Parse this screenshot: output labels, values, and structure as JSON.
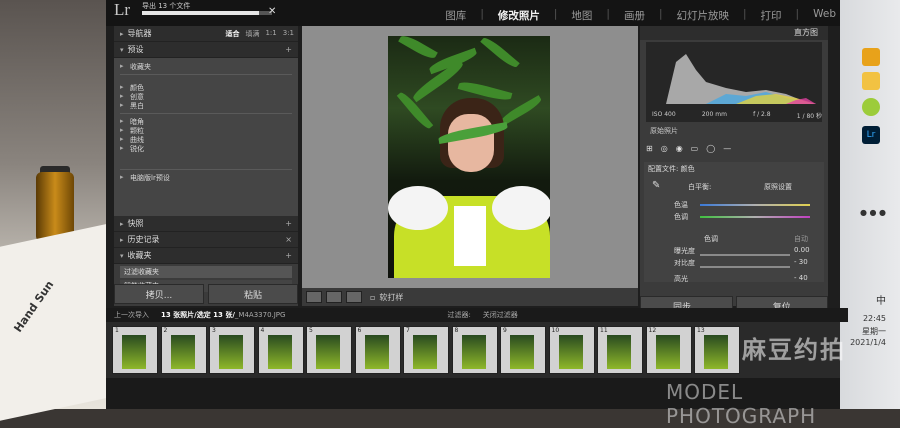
{
  "import": {
    "label": "导出 13 个文件",
    "progress_pct": 90,
    "close": "✕"
  },
  "logo": "Lr",
  "modules": [
    "图库",
    "修改照片",
    "地图",
    "画册",
    "幻灯片放映",
    "打印",
    "Web"
  ],
  "active_module": "修改照片",
  "left": {
    "navigator": {
      "title": "导航器",
      "opts": [
        "适合",
        "填满",
        "1:1",
        "3:1"
      ]
    },
    "presets": {
      "title": "预设",
      "items": [
        "收藏夹",
        "颜色",
        "创意",
        "黑白",
        "暗角",
        "颗粒",
        "曲线",
        "锐化",
        "电脑版lr预设"
      ]
    },
    "snapshots": "快照",
    "history": "历史记录",
    "collections": "收藏夹",
    "collection_items": [
      "过滤收藏夹",
      "智能收藏夹"
    ],
    "copy": "拷贝...",
    "paste": "粘贴"
  },
  "toolbar": {
    "softproof": "软打样"
  },
  "right": {
    "histogram": "直方图",
    "stats": [
      "ISO 400",
      "200 mm",
      "f / 2.8",
      "1 / 80 秒"
    ],
    "original": "原始照片",
    "profile": "配置文件: 颜色",
    "wb_label": "白平衡:",
    "wb_value": "原照设置",
    "temp": "色温",
    "tint": "色调",
    "tone": "色调",
    "auto": "自动",
    "exposure": "曝光度",
    "exposure_val": "0.00",
    "contrast": "对比度",
    "contrast_val": "- 30",
    "highlights": "高光",
    "highlights_val": "- 40",
    "sync": "同步...",
    "reset": "复位"
  },
  "filmstrip": {
    "prev_import": "上一次导入",
    "count": "13 张照片/选定 13 张/",
    "filename": "_M4A3370.JPG",
    "filter": "过滤器:",
    "filter_val": "关闭过滤器",
    "cells": [
      "1",
      "2",
      "3",
      "4",
      "5",
      "6",
      "7",
      "8",
      "9",
      "10",
      "11",
      "12",
      "13"
    ]
  },
  "watermark": {
    "cn": "麻豆约拍",
    "en": "MODEL PHOTOGRAPH"
  },
  "taskbar": {
    "time": "22:45",
    "day": "星期一",
    "date": "2021/1/4",
    "lang": "中"
  },
  "paper_text": "Hand Sun"
}
